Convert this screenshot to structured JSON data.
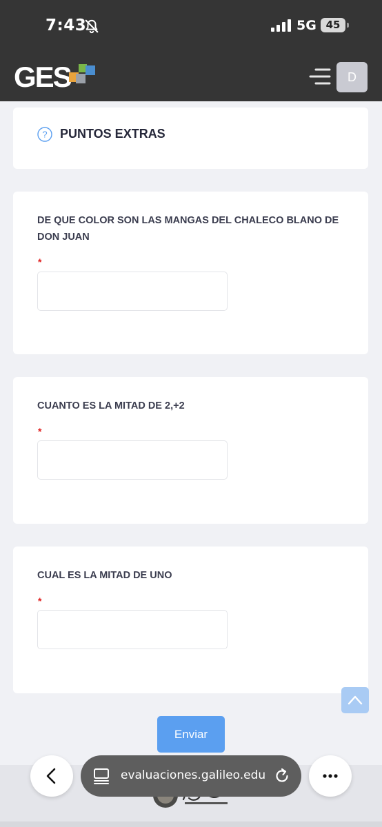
{
  "status_bar": {
    "time": "7:43",
    "network": "5G",
    "battery": "45",
    "icons": [
      "bell-slash-icon",
      "signal-icon"
    ]
  },
  "header": {
    "logo_text": "GES",
    "avatar_initial": "D",
    "logo_colors": [
      "#e8a33d",
      "#7ab648",
      "#4a8ed0",
      "#9aa0a8"
    ]
  },
  "section": {
    "title": "PUNTOS EXTRAS",
    "icon": "help-circle-icon"
  },
  "questions": [
    {
      "text": "DE QUE COLOR SON LAS MANGAS DEL CHALECO BLANO DE DON JUAN",
      "required_mark": "*",
      "value": ""
    },
    {
      "text": "CUANTO ES LA MITAD DE 2,+2",
      "required_mark": "*",
      "value": ""
    },
    {
      "text": "CUAL ES LA MITAD DE UNO",
      "required_mark": "*",
      "value": ""
    }
  ],
  "submit_label": "Enviar",
  "browser": {
    "url": "evaluaciones.galileo.edu",
    "icons": [
      "back-chevron-icon",
      "tabs-icon",
      "reload-icon",
      "more-dots-icon"
    ]
  },
  "colors": {
    "header_bg": "#353535",
    "page_bg": "#f0f1f5",
    "accent": "#5b9ff0",
    "required": "#e02020"
  }
}
